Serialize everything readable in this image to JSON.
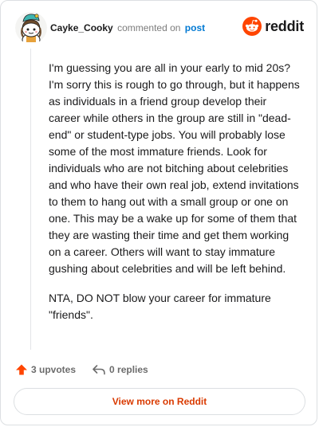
{
  "header": {
    "author": "Cayke_Cooky",
    "action_text": "commented on",
    "post_link": "post",
    "brand_wordmark": "reddit",
    "brand_color": "#ff4500"
  },
  "comment": {
    "paragraphs": [
      "I'm guessing you are all in your early to mid 20s? I'm sorry this is rough to go through, but it happens as individuals in a friend group develop their career while others in the group are still in \"dead-end\" or student-type jobs. You will probably lose some of the most immature friends. Look for individuals who are not bitching about celebrities and who have their own real job, extend invitations to them to hang out with a small group or one on one. This may be a wake up for some of them that they are wasting their time and get them working on a career. Others will want to stay immature gushing about celebrities and will be left behind.",
      "NTA, DO NOT blow your career for immature \"friends\"."
    ]
  },
  "actions": {
    "upvotes": "3 upvotes",
    "replies": "0 replies",
    "upvote_icon": "upvote-arrow-icon",
    "reply_icon": "reply-icon",
    "upvote_color": "#ff4500"
  },
  "footer": {
    "view_more": "View more on Reddit",
    "view_more_color": "#d93a00"
  }
}
